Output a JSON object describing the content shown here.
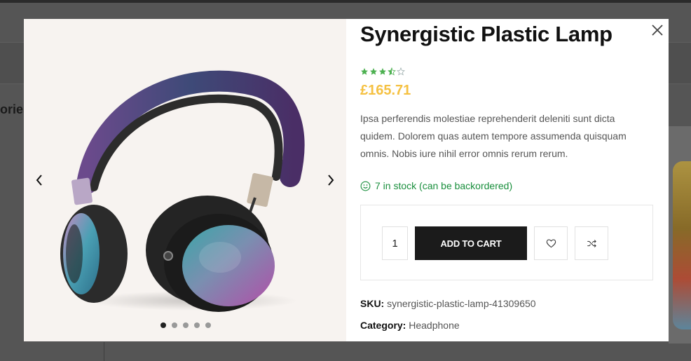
{
  "background": {
    "partial_text": "ories"
  },
  "product": {
    "title": "Synergistic Plastic Lamp",
    "rating": 3.5,
    "rating_max": 5,
    "price": "£165.71",
    "description": "Ipsa perferendis molestiae reprehenderit deleniti sunt dicta quidem. Dolorem quas autem tempore assumenda quisquam omnis. Nobis iure nihil error omnis rerum rerum.",
    "stock": "7 in stock (can be backordered)",
    "quantity": "1",
    "add_to_cart_label": "ADD TO CART",
    "sku_label": "SKU:",
    "sku": "synergistic-plastic-lamp-41309650",
    "category_label": "Category:",
    "category": "Headphone"
  },
  "gallery": {
    "slide_count": 5,
    "active_slide": 1
  },
  "colors": {
    "price": "#f5c142",
    "stars": "#4cb050",
    "stock": "#1a8f3d",
    "button": "#1b1b1b"
  },
  "icons": {
    "close": "close-icon",
    "prev": "chevron-left-icon",
    "next": "chevron-right-icon",
    "wishlist": "heart-icon",
    "compare": "shuffle-icon",
    "stock": "smiley-icon"
  }
}
